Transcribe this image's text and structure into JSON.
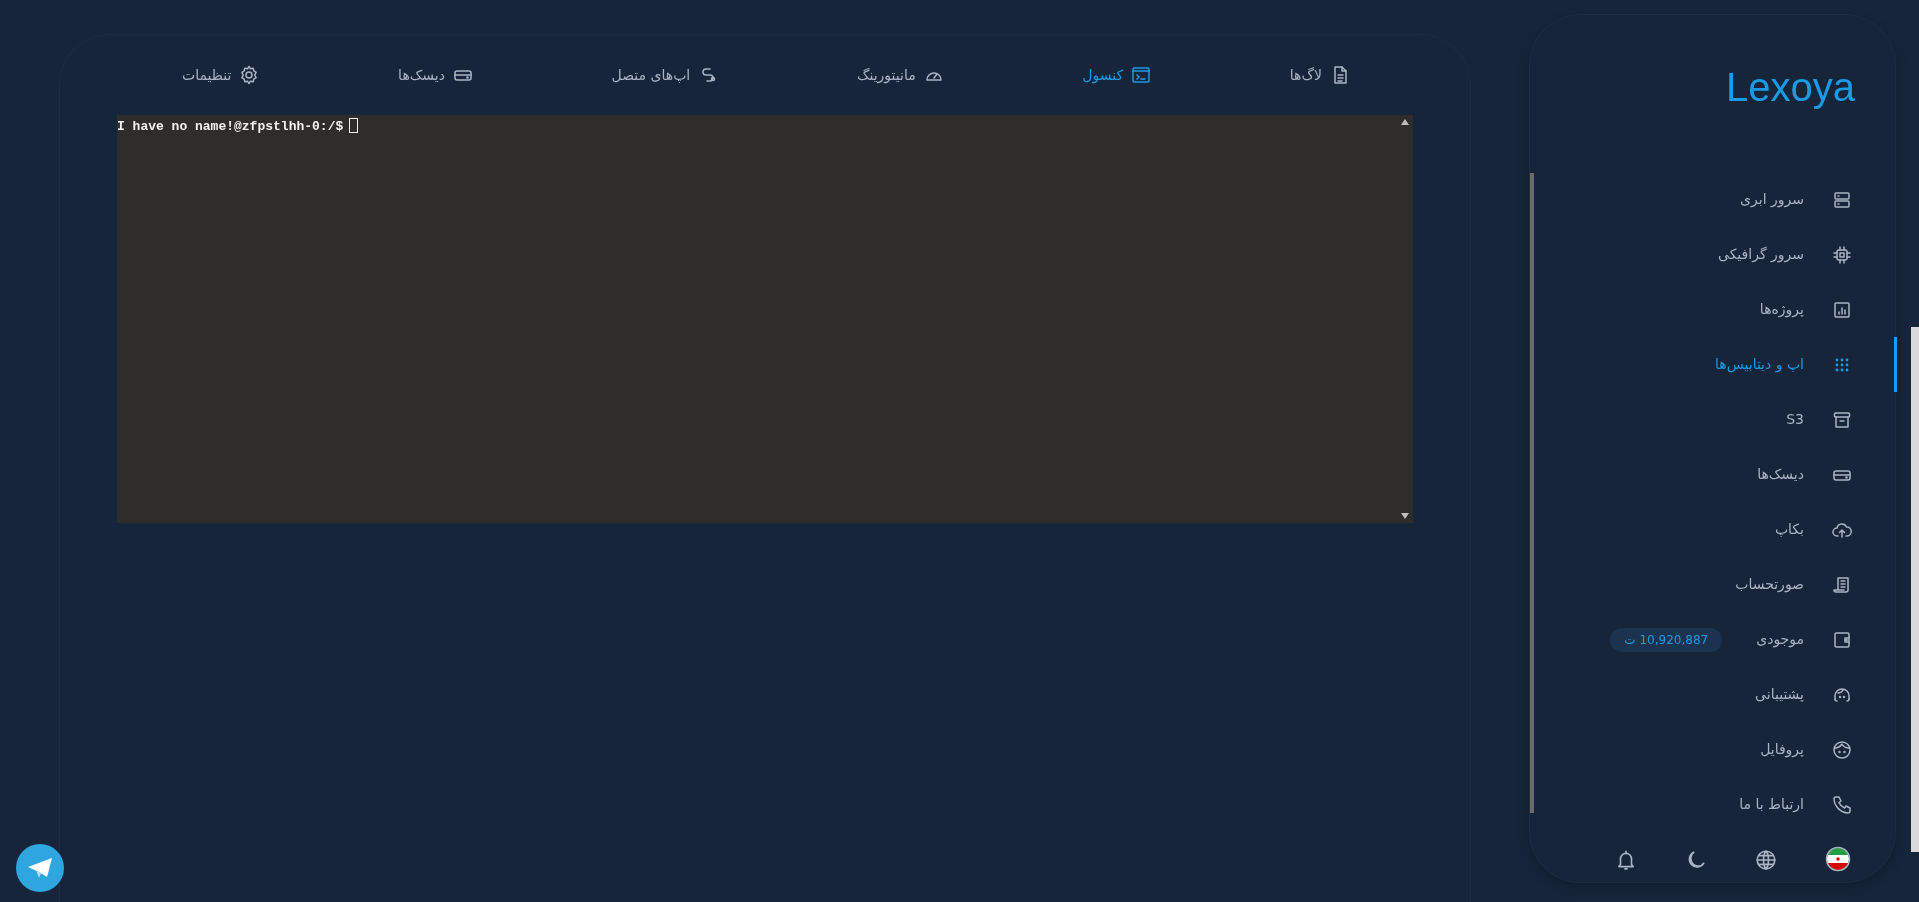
{
  "tabs": [
    {
      "label": "لاگ‌ها",
      "selected": false
    },
    {
      "label": "کنسول",
      "selected": true
    },
    {
      "label": "مانیتورینگ",
      "selected": false
    },
    {
      "label": "اپ‌های متصل",
      "selected": false
    },
    {
      "label": "دیسک‌ها",
      "selected": false
    },
    {
      "label": "تنظیمات",
      "selected": false
    }
  ],
  "terminal": {
    "prompt": "I have no name!@zfpstlhh-0:/$"
  },
  "sidebar": {
    "brand": "Lexoya",
    "items": [
      {
        "label": "سرور ابری",
        "selected": false
      },
      {
        "label": "سرور گرافیکی",
        "selected": false
      },
      {
        "label": "پروژه‌ها",
        "selected": false
      },
      {
        "label": "اپ و دیتابیس‌ها",
        "selected": true
      },
      {
        "label": "S3",
        "selected": false
      },
      {
        "label": "دیسک‌ها",
        "selected": false
      },
      {
        "label": "بکاپ",
        "selected": false
      },
      {
        "label": "صورتحساب",
        "selected": false
      },
      {
        "label": "موجودی",
        "selected": false,
        "badge": "10,920,887 ت"
      },
      {
        "label": "پشتیبانی",
        "selected": false
      },
      {
        "label": "پروفایل",
        "selected": false
      },
      {
        "label": "ارتباط با ما",
        "selected": false
      }
    ]
  }
}
